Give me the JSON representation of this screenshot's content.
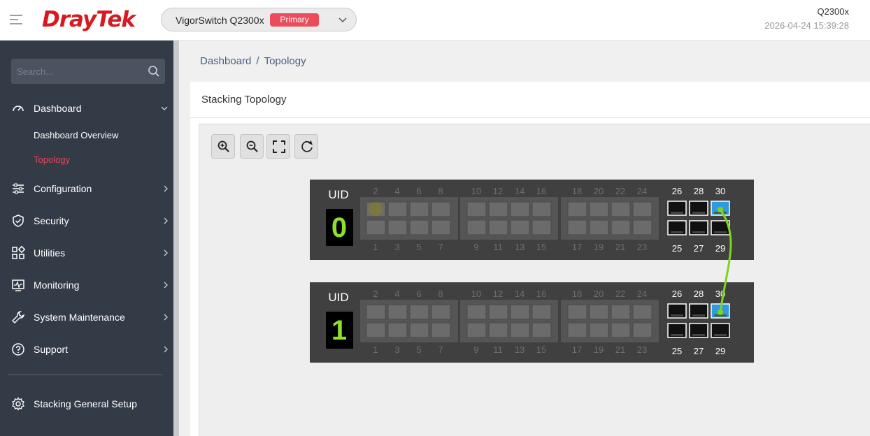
{
  "header": {
    "logo_text": "DrayTek",
    "device_name": "VigorSwitch Q2300x",
    "device_role": "Primary",
    "model": "Q2300x",
    "datetime": "2026-04-24 15:39:28"
  },
  "sidebar": {
    "search_placeholder": "Search...",
    "items": [
      {
        "label": "Dashboard",
        "icon": "gauge-icon",
        "expanded": true
      },
      {
        "label": "Configuration",
        "icon": "sliders-icon"
      },
      {
        "label": "Security",
        "icon": "shield-check-icon"
      },
      {
        "label": "Utilities",
        "icon": "grid-icon"
      },
      {
        "label": "Monitoring",
        "icon": "monitor-pulse-icon"
      },
      {
        "label": "System Maintenance",
        "icon": "wrench-icon"
      },
      {
        "label": "Support",
        "icon": "question-circle-icon"
      }
    ],
    "dashboard_sub": [
      {
        "label": "Dashboard Overview",
        "active": false
      },
      {
        "label": "Topology",
        "active": true
      }
    ],
    "footer_item": {
      "label": "Stacking General Setup",
      "icon": "gear-icon"
    }
  },
  "breadcrumb": {
    "parent": "Dashboard",
    "sep": "/",
    "current": "Topology"
  },
  "panel": {
    "title": "Stacking Topology"
  },
  "toolbar": {
    "buttons": [
      {
        "name": "zoom-in-button",
        "icon": "zoom-in-icon"
      },
      {
        "name": "zoom-out-button",
        "icon": "zoom-out-icon"
      },
      {
        "name": "fit-screen-button",
        "icon": "fit-screen-icon"
      },
      {
        "name": "refresh-button",
        "icon": "refresh-icon"
      }
    ]
  },
  "switches": [
    {
      "uid_label": "UID",
      "uid": "0",
      "copper_top": [
        "2",
        "4",
        "6",
        "8",
        "10",
        "12",
        "14",
        "16",
        "18",
        "20",
        "22",
        "24"
      ],
      "copper_bottom": [
        "1",
        "3",
        "5",
        "7",
        "9",
        "11",
        "13",
        "15",
        "17",
        "19",
        "21",
        "23"
      ],
      "sfp_top": [
        "26",
        "28",
        "30"
      ],
      "sfp_bottom": [
        "25",
        "27",
        "29"
      ],
      "active_copper_port": "2",
      "stack_port": "30"
    },
    {
      "uid_label": "UID",
      "uid": "1",
      "copper_top": [
        "2",
        "4",
        "6",
        "8",
        "10",
        "12",
        "14",
        "16",
        "18",
        "20",
        "22",
        "24"
      ],
      "copper_bottom": [
        "1",
        "3",
        "5",
        "7",
        "9",
        "11",
        "13",
        "15",
        "17",
        "19",
        "21",
        "23"
      ],
      "sfp_top": [
        "26",
        "28",
        "30"
      ],
      "sfp_bottom": [
        "25",
        "27",
        "29"
      ],
      "active_copper_port": "",
      "stack_port": "30"
    }
  ],
  "stack_link": {
    "from": "UID 0 port 30",
    "to": "UID 1 port 30",
    "color": "#7ed321"
  },
  "colors": {
    "brand": "#d71a21",
    "badge": "#ec4c5a",
    "sidebar_bg": "#333b47",
    "active_nav": "#e8475a",
    "uid_digit": "#8fe02a",
    "sfp_stack": "#2e9be0"
  }
}
